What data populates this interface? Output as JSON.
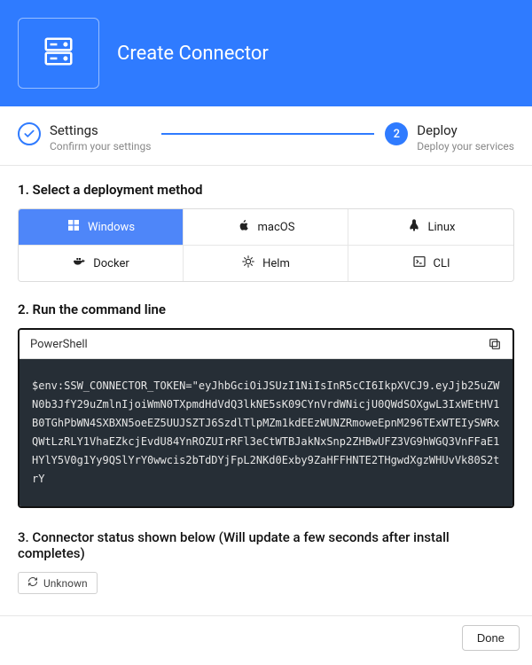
{
  "header": {
    "title": "Create Connector"
  },
  "stepper": {
    "step1": {
      "label": "Settings",
      "sub": "Confirm your settings"
    },
    "step2": {
      "num": "2",
      "label": "Deploy",
      "sub": "Deploy your services"
    }
  },
  "sections": {
    "s1": "1. Select a deployment method",
    "s2": "2. Run the command line",
    "s3": "3. Connector status shown below (Will update a few seconds after install completes)"
  },
  "deploy": {
    "windows": "Windows",
    "macos": "macOS",
    "linux": "Linux",
    "docker": "Docker",
    "helm": "Helm",
    "cli": "CLI"
  },
  "cmd": {
    "shell": "PowerShell",
    "text": "$env:SSW_CONNECTOR_TOKEN=\"eyJhbGciOiJSUzI1NiIsInR5cCI6IkpXVCJ9.eyJjb25uZWN0b3JfY29uZmlnIjoiWmN0TXpmdHdVdQ3lkNE5sK09CYnVrdWNicjU0QWdSOXgwL3IxWEtHV1B0TGhPbWN4SXBXN5oeEZ5UUJSZTJ6SzdlTlpMZm1kdEEzWUNZRmoweEpnM296TExWTEIySWRxQWtLzRLY1VhaEZkcjEvdU84YnROZUIrRFl3eCtWTBJakNxSnp2ZHBwUFZ3VG9hWGQ3VnFFaE1HYlY5V0g1Yy9QSlYrY0wwcis2bTdDYjFpL2NKd0Exby9ZaHFFHNTE2THgwdXgzWHUvVk80S2trY"
  },
  "status": {
    "label": "Unknown"
  },
  "footer": {
    "done": "Done"
  }
}
